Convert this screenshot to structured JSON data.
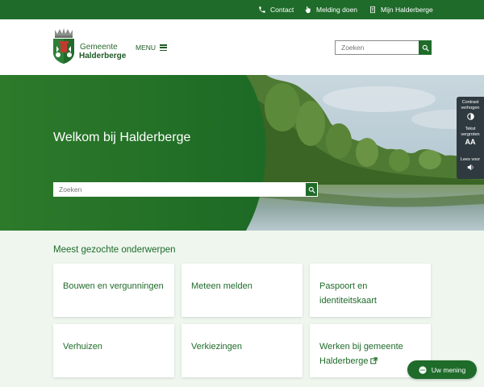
{
  "topbar": {
    "links": [
      {
        "label": "Contact",
        "icon": "phone-icon"
      },
      {
        "label": "Melding doen",
        "icon": "pointing-hand-icon"
      },
      {
        "label": "Mijn Halderberge",
        "icon": "document-icon"
      }
    ]
  },
  "header": {
    "logo_line1": "Gemeente",
    "logo_line2": "Halderberge",
    "menu_label": "MENU",
    "search_placeholder": "Zoeken"
  },
  "hero": {
    "title": "Welkom bij Halderberge",
    "search_placeholder": "Zoeken"
  },
  "a11y": {
    "contrast_label": "Contrast verhogen",
    "text_label": "Tekst vergroten",
    "text_glyph": "AA",
    "read_label": "Lees voor"
  },
  "main": {
    "section_title": "Meest gezochte onderwerpen",
    "cards": [
      {
        "label": "Bouwen en vergunningen"
      },
      {
        "label": "Meteen melden"
      },
      {
        "label": "Paspoort en identiteitskaart"
      },
      {
        "label": "Verhuizen"
      },
      {
        "label": "Verkiezingen"
      },
      {
        "label": "Werken bij gemeente Halderberge",
        "icon": "external-link-icon"
      }
    ]
  },
  "feedback": {
    "label": "Uw mening"
  },
  "colors": {
    "brand_green": "#1f6b2a",
    "page_bg": "#eef6ee",
    "toolbar_dark": "#2f3a40"
  }
}
